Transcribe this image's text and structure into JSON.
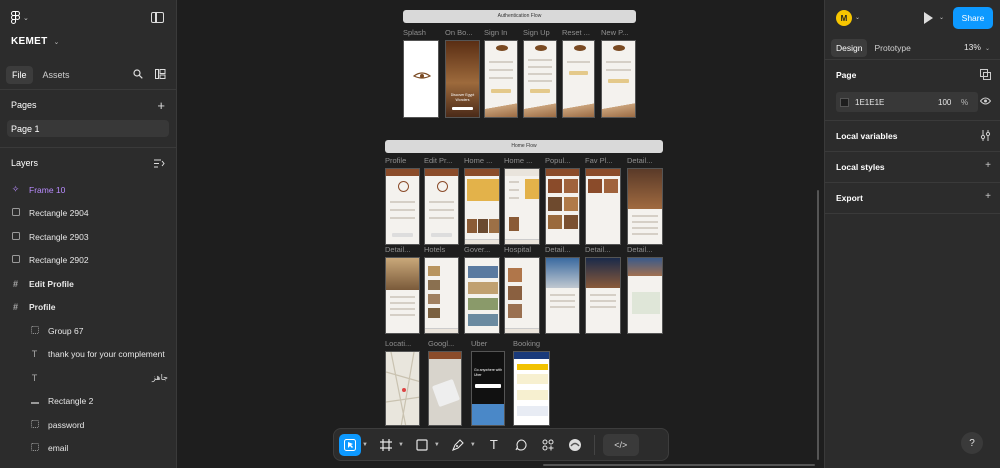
{
  "app": {
    "project_name": "KEMET",
    "tabs": [
      "File",
      "Assets"
    ],
    "pages_title": "Pages",
    "pages": [
      "Page 1"
    ],
    "layers_title": "Layers",
    "layers": [
      {
        "label": "Frame 10",
        "icon": "frame-diamond-icon"
      },
      {
        "label": "Rectangle 2904",
        "icon": "rectangle-icon"
      },
      {
        "label": "Rectangle 2903",
        "icon": "rectangle-icon"
      },
      {
        "label": "Rectangle 2902",
        "icon": "rectangle-icon"
      },
      {
        "label": "Edit Profile",
        "icon": "frame-hash-icon"
      },
      {
        "label": "Profile",
        "icon": "frame-hash-icon"
      },
      {
        "label": "Group 67",
        "icon": "group-icon"
      },
      {
        "label": "thank you for your complement",
        "icon": "text-icon"
      },
      {
        "label": "",
        "icon": "text-icon",
        "side_text": "جاهز"
      },
      {
        "label": "Rectangle 2",
        "icon": "line-icon"
      },
      {
        "label": "password",
        "icon": "group-icon"
      },
      {
        "label": "email",
        "icon": "group-icon"
      }
    ]
  },
  "canvas": {
    "auth_flow": {
      "title": "Authentication Flow",
      "screens": [
        "Splash",
        "On Bo...",
        "Sign In",
        "Sign Up",
        "Reset ...",
        "New P..."
      ],
      "onboarding_text": "Discover Egypt Wonders"
    },
    "home_flow": {
      "title": "Home  Flow",
      "row1": [
        "Profile",
        "Edit Pr...",
        "Home ...",
        "Home ...",
        "Popul...",
        "Fav Pl...",
        "Detail..."
      ],
      "row2": [
        "Detail...",
        "Hotels",
        "Gover...",
        "Hospital",
        "Detail...",
        "Detail...",
        "Detail..."
      ],
      "row3": [
        "Locati...",
        "Googl...",
        "Uber",
        "Booking"
      ],
      "uber_text": "Go anywhere with Uber"
    }
  },
  "toolbar": {
    "tools": [
      "move-tool",
      "frame-tool",
      "shape-tool",
      "pen-tool",
      "text-tool",
      "comment-tool",
      "actions-tool",
      "plugin-tool",
      "dev-mode-toggle"
    ]
  },
  "right_panel": {
    "avatar_letter": "M",
    "share_label": "Share",
    "tabs": [
      "Design",
      "Prototype"
    ],
    "zoom": "13%",
    "page_section": "Page",
    "page_color": "1E1E1E",
    "page_opacity": "100",
    "opacity_unit": "%",
    "local_variables": "Local variables",
    "local_styles": "Local styles",
    "export": "Export"
  },
  "help_label": "?",
  "colors": {
    "accent": "#0d99ff",
    "selected_layer": "#b98cff",
    "panel_bg": "#2c2c2c",
    "canvas_bg": "#1e1e1e",
    "avatar_bg": "#f7c600"
  }
}
